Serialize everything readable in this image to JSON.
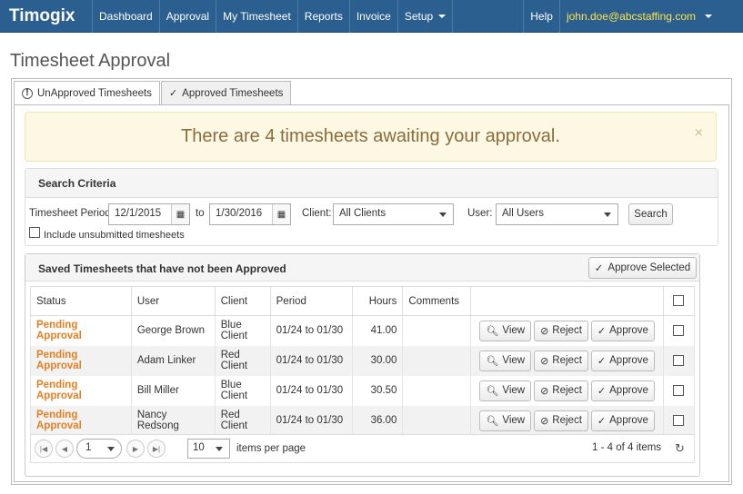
{
  "nav": {
    "brand": "Timogix",
    "items": [
      "Dashboard",
      "Approval",
      "My Timesheet",
      "Reports",
      "Invoice",
      "Setup"
    ],
    "help": "Help",
    "user": "john.doe@abcstaffing.com"
  },
  "page_title": "Timesheet Approval",
  "tabs": [
    {
      "label": "UnApproved Timesheets",
      "icon": "exclamation-circle-icon"
    },
    {
      "label": "Approved Timesheets",
      "icon": "check-icon"
    }
  ],
  "alert": {
    "text": "There are 4 timesheets awaiting your approval.",
    "close": "×"
  },
  "search": {
    "title": "Search Criteria",
    "period_label": "Timesheet Period:",
    "from": "12/1/2015",
    "to_label": "to",
    "to": "1/30/2016",
    "client_label": "Client:",
    "client_value": "All Clients",
    "user_label": "User:",
    "user_value": "All Users",
    "search_button": "Search",
    "include_label": "Include unsubmitted timesheets"
  },
  "grid": {
    "title": "Saved Timesheets that have not been Approved",
    "approve_selected": "Approve Selected",
    "columns": [
      "Status",
      "User",
      "Client",
      "Period",
      "Hours",
      "Comments"
    ],
    "rows": [
      {
        "status": "Pending Approval",
        "user": "George Brown",
        "client": "Blue Client",
        "period": "01/24 to 01/30",
        "hours": "41.00",
        "comments": ""
      },
      {
        "status": "Pending Approval",
        "user": "Adam Linker",
        "client": "Red Client",
        "period": "01/24 to 01/30",
        "hours": "30.00",
        "comments": ""
      },
      {
        "status": "Pending Approval",
        "user": "Bill Miller",
        "client": "Blue Client",
        "period": "01/24 to 01/30",
        "hours": "30.50",
        "comments": ""
      },
      {
        "status": "Pending Approval",
        "user": "Nancy Redsong",
        "client": "Red Client",
        "period": "01/24 to 01/30",
        "hours": "36.00",
        "comments": ""
      }
    ],
    "actions": {
      "view": "View",
      "reject": "Reject",
      "approve": "Approve"
    },
    "pager": {
      "page": "1",
      "page_size": "10",
      "items_per_page": "items per page",
      "summary": "1 - 4 of 4 items"
    }
  }
}
